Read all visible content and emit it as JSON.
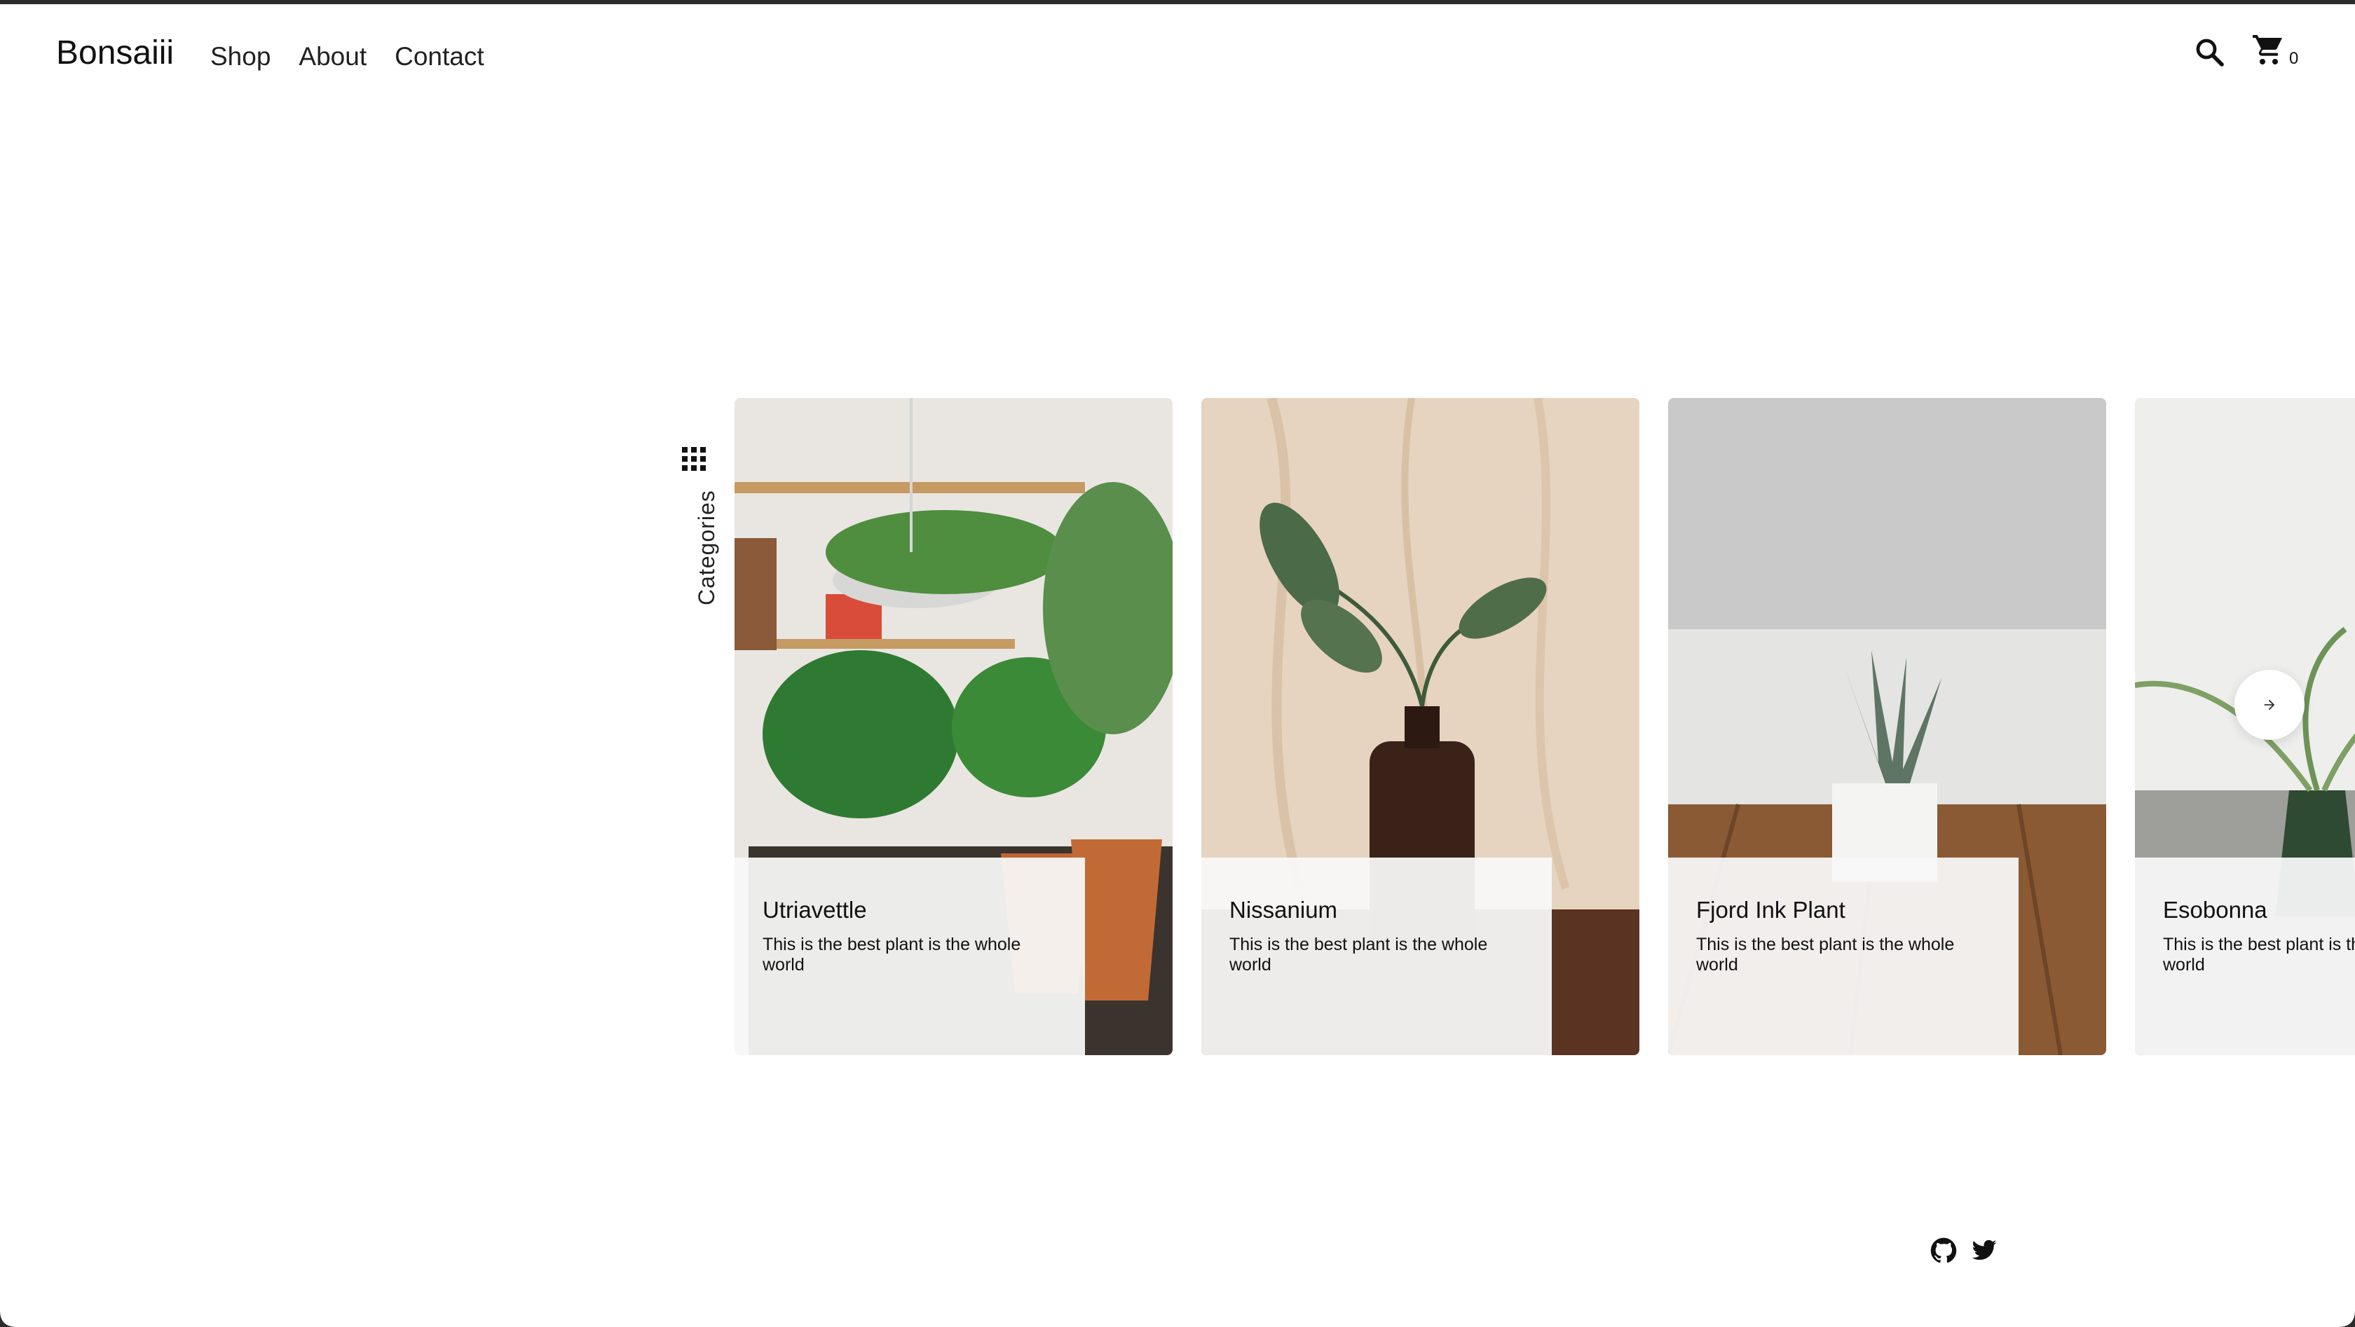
{
  "header": {
    "logo": "Bonsaiii",
    "nav": [
      "Shop",
      "About",
      "Contact"
    ],
    "cart_count": "0"
  },
  "sidebar": {
    "categories_label": "Categories"
  },
  "products": [
    {
      "name": "Utriavettle",
      "description": "This is the best plant is the whole world"
    },
    {
      "name": "Nissanium",
      "description": "This is the best plant is the whole world"
    },
    {
      "name": "Fjord Ink Plant",
      "description": "This is the best plant is the whole world"
    },
    {
      "name": "Esobonna",
      "description": "This is the best plant is the whole world"
    }
  ],
  "icons": {
    "search": "search-icon",
    "cart": "cart-icon",
    "categories": "grid-icon",
    "next": "arrow-right-icon",
    "github": "github-icon",
    "twitter": "twitter-icon"
  },
  "colors": {
    "text": "#111111",
    "border": "#2b2b2b",
    "caption_bg": "#f8f8f8"
  }
}
